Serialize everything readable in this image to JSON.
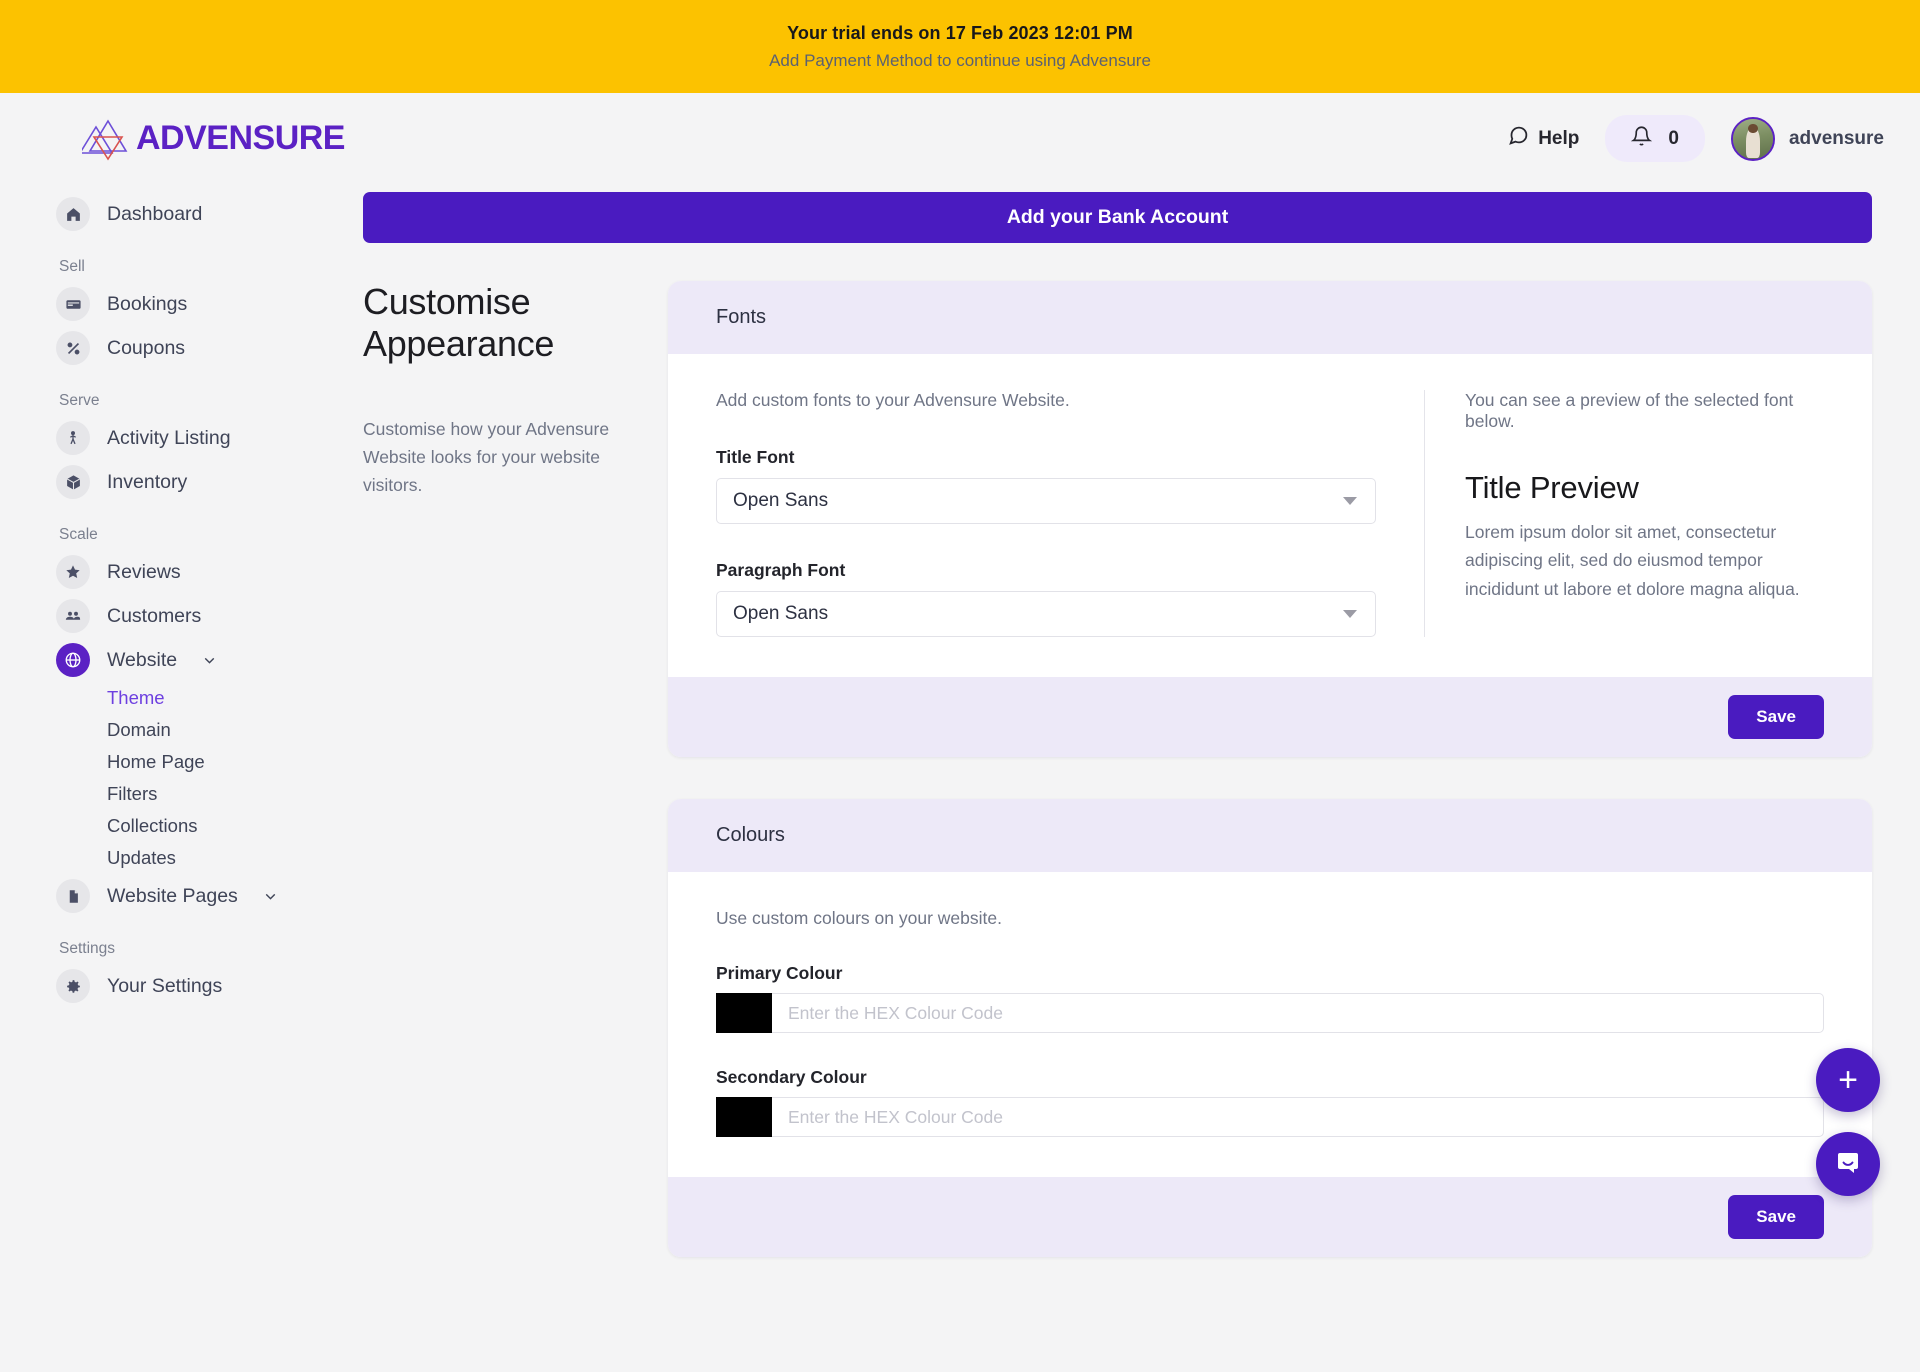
{
  "trial_banner": {
    "title": "Your trial ends on 17 Feb 2023 12:01 PM",
    "subtitle": "Add Payment Method to continue using Advensure",
    "bg_color": "#fcc200"
  },
  "topbar": {
    "brand_name": "ADVENSURE",
    "brand_color": "#5b21c4",
    "help_label": "Help",
    "help_icon": "chat-bubble-icon",
    "notification_icon": "bell-icon",
    "notification_count": "0",
    "username": "advensure",
    "avatar_icon": "user-avatar"
  },
  "sidebar": {
    "dashboard": {
      "label": "Dashboard",
      "icon": "home-icon"
    },
    "groups": [
      {
        "title": "Sell",
        "items": [
          {
            "label": "Bookings",
            "icon": "card-icon"
          },
          {
            "label": "Coupons",
            "icon": "percent-icon"
          }
        ]
      },
      {
        "title": "Serve",
        "items": [
          {
            "label": "Activity Listing",
            "icon": "walking-person-icon"
          },
          {
            "label": "Inventory",
            "icon": "box-icon"
          }
        ]
      }
    ],
    "scale": {
      "title": "Scale",
      "reviews": {
        "label": "Reviews",
        "icon": "star-icon"
      },
      "customers": {
        "label": "Customers",
        "icon": "people-icon"
      },
      "website": {
        "label": "Website",
        "icon": "globe-icon",
        "active": true,
        "caret": "chevron-down-icon",
        "sub_items": [
          {
            "label": "Theme",
            "current": true
          },
          {
            "label": "Domain",
            "current": false
          },
          {
            "label": "Home Page",
            "current": false
          },
          {
            "label": "Filters",
            "current": false
          },
          {
            "label": "Collections",
            "current": false
          },
          {
            "label": "Updates",
            "current": false
          }
        ]
      },
      "website_pages": {
        "label": "Website Pages",
        "icon": "document-icon",
        "caret": "chevron-down-icon"
      }
    },
    "settings": {
      "title": "Settings",
      "your_settings": {
        "label": "Your Settings",
        "icon": "gear-icon"
      }
    }
  },
  "main": {
    "bank_banner_label": "Add your Bank Account",
    "page_title": "Customise Appearance",
    "page_description": "Customise how your Advensure Website looks for your website visitors.",
    "fonts_card": {
      "heading": "Fonts",
      "hint": "Add custom fonts to your Advensure Website.",
      "title_font_label": "Title Font",
      "title_font_value": "Open Sans",
      "paragraph_font_label": "Paragraph Font",
      "paragraph_font_value": "Open Sans",
      "preview_hint": "You can see a preview of the selected font below.",
      "preview_title": "Title Preview",
      "preview_body": "Lorem ipsum dolor sit amet, consectetur adipiscing elit, sed do eiusmod tempor incididunt ut labore et dolore magna aliqua.",
      "save_label": "Save"
    },
    "colours_card": {
      "heading": "Colours",
      "hint": "Use custom colours on your website.",
      "primary_label": "Primary Colour",
      "primary_value": "",
      "primary_placeholder": "Enter the HEX Colour Code",
      "primary_swatch": "#000000",
      "secondary_label": "Secondary Colour",
      "secondary_value": "",
      "secondary_placeholder": "Enter the HEX Colour Code",
      "secondary_swatch": "#000000",
      "save_label": "Save"
    }
  },
  "fabs": {
    "add_label": "+",
    "add_icon": "plus-icon",
    "chat_icon": "chat-smile-icon"
  },
  "theme": {
    "accent": "#4a1bc0",
    "card_header_bg": "#ede9f8",
    "page_bg": "#f4f4f5"
  }
}
